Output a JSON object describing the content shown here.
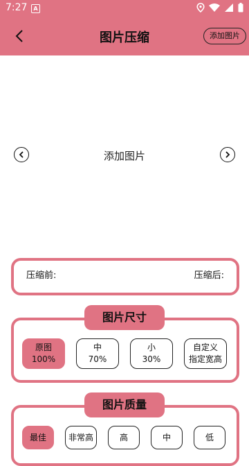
{
  "status": {
    "time": "7:27",
    "notif_letter": "A"
  },
  "header": {
    "title": "图片压缩",
    "add_button": "添加图片"
  },
  "preview": {
    "label": "添加图片"
  },
  "compare": {
    "before": "压缩前:",
    "after": "压缩后:"
  },
  "size_section": {
    "title": "图片尺寸",
    "options": [
      {
        "name": "原图",
        "value": "100%"
      },
      {
        "name": "中",
        "value": "70%"
      },
      {
        "name": "小",
        "value": "30%"
      },
      {
        "name": "自定义",
        "value": "指定宽高"
      }
    ],
    "selected_index": 0
  },
  "quality_section": {
    "title": "图片质量",
    "options": [
      "最佳",
      "非常高",
      "高",
      "中",
      "低"
    ],
    "selected_index": 0
  },
  "colors": {
    "accent": "#e07383",
    "border": "#222222"
  }
}
